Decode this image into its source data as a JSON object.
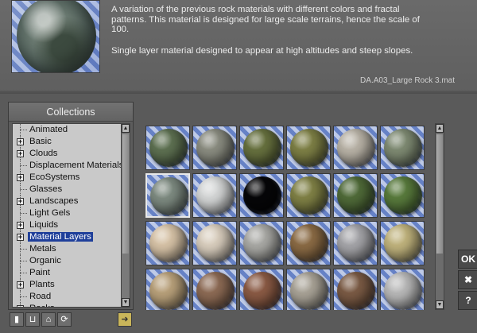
{
  "description": {
    "paragraph1": "A variation of the previous rock materials with different colors and fractal patterns. This material is designed for large scale terrains, hence the scale of 100.",
    "paragraph2": "Single layer material designed to appear at high altitudes and steep slopes.",
    "file_name": "DA.A03_Large Rock 3.mat"
  },
  "collections": {
    "title": "Collections",
    "items": [
      {
        "label": "Animated",
        "expandable": false
      },
      {
        "label": "Basic",
        "expandable": true
      },
      {
        "label": "Clouds",
        "expandable": true
      },
      {
        "label": "Displacement Materials",
        "expandable": false
      },
      {
        "label": "EcoSystems",
        "expandable": true
      },
      {
        "label": "Glasses",
        "expandable": false
      },
      {
        "label": "Landscapes",
        "expandable": true
      },
      {
        "label": "Light Gels",
        "expandable": false
      },
      {
        "label": "Liquids",
        "expandable": true
      },
      {
        "label": "Material Layers",
        "expandable": true,
        "selected": true
      },
      {
        "label": "Metals",
        "expandable": false
      },
      {
        "label": "Organic",
        "expandable": false
      },
      {
        "label": "Paint",
        "expandable": false
      },
      {
        "label": "Plants",
        "expandable": true
      },
      {
        "label": "Road",
        "expandable": false
      },
      {
        "label": "Rocks",
        "expandable": true
      }
    ]
  },
  "toolbar": {
    "icons": [
      "new-icon",
      "lock-icon",
      "trash-icon",
      "refresh-icon",
      "next-arrow-icon"
    ]
  },
  "materials": [
    [
      "#5d7051",
      "#8a8c80",
      "#66703e",
      "#7d7f45",
      "#b8b2a6",
      "#7e8a72"
    ],
    [
      "#7d8a80",
      "#d4d6d6",
      "#060608",
      "#7f8045",
      "#4f6a38",
      "#587a3c"
    ],
    [
      "#d6c2a6",
      "#d8cdbd",
      "#a8a8a4",
      "#8a6a44",
      "#a4a4a8",
      "#bfb27c"
    ],
    [
      "#b8a07a",
      "#8c6a54",
      "#8a5a44",
      "#a8a296",
      "#7a5a44",
      "#b8b8b8"
    ]
  ],
  "selected_material": [
    1,
    0
  ],
  "side_buttons": {
    "ok": "OK",
    "cancel": "✖",
    "help": "?"
  }
}
